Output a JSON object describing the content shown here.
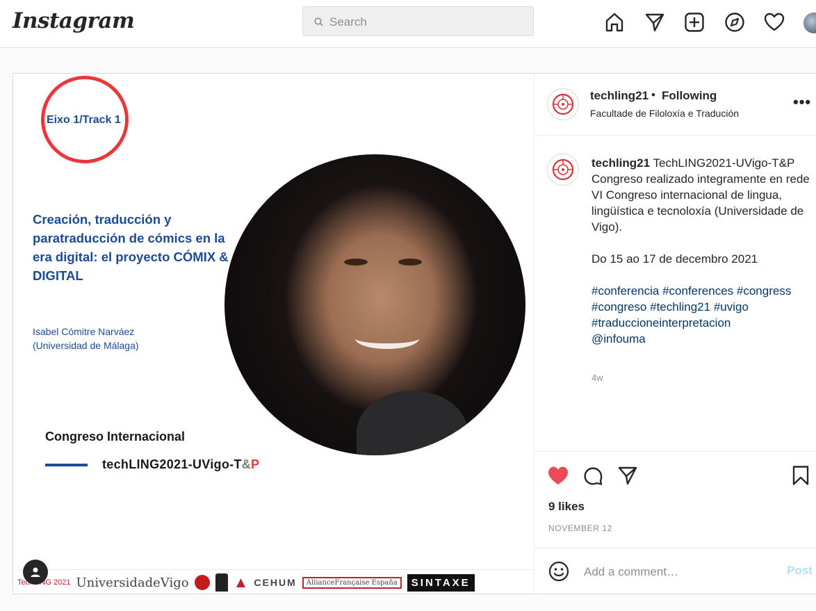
{
  "header": {
    "logo": "Instagram",
    "search_placeholder": "Search",
    "nav_icons": [
      "home-icon",
      "direct-icon",
      "new-post-icon",
      "explore-icon",
      "activity-icon",
      "profile-avatar"
    ]
  },
  "media": {
    "track_label": "Eixo 1/Track 1",
    "talk_title": "Creación, traducción y paratraducción de cómics en la era digital: el proyecto CÓMIX & DIGITAL",
    "speaker": "Isabel Cómitre Narváez\n(Universidad de Málaga)",
    "congress_label": "Congreso Internacional",
    "conf_name_main": "techLING2021-UVigo-T",
    "conf_name_amp": "&",
    "conf_name_p": "P",
    "sponsors": [
      "TechLING 2021",
      "UniversidadeVigo",
      "CEHUM",
      "AllianceFrançaise España",
      "SINTAXE"
    ]
  },
  "post": {
    "username": "techling21",
    "separator": "•",
    "follow_status": "Following",
    "location": "Facultade de Filoloxía e Tradución",
    "more": "•••",
    "caption_user": "techling21",
    "caption_first": " TechLING2021-UVigo-T&P Congreso realizado integramente en rede",
    "caption_line2": "VI Congreso internacional de lingua, lingüística e tecnoloxía (Universidade de Vigo).",
    "caption_dates": "Do 15 ao 17 de decembro 2021",
    "hashtags": [
      "#conferencia",
      "#conferences",
      "#congress",
      "#congreso",
      "#techling21",
      "#uvigo",
      "#traduccioneinterpretacion"
    ],
    "mention": "@infouma",
    "time_ago": "4w",
    "likes": "9 likes",
    "date": "NOVEMBER 12",
    "comment_placeholder": "Add a comment…",
    "post_button": "Post"
  },
  "colors": {
    "brand_blue": "#1c4b93",
    "accent_red": "#e8383a",
    "like_red": "#ed4956",
    "post_button_disabled": "#b2dffc",
    "hashtag_blue": "#00376b"
  }
}
